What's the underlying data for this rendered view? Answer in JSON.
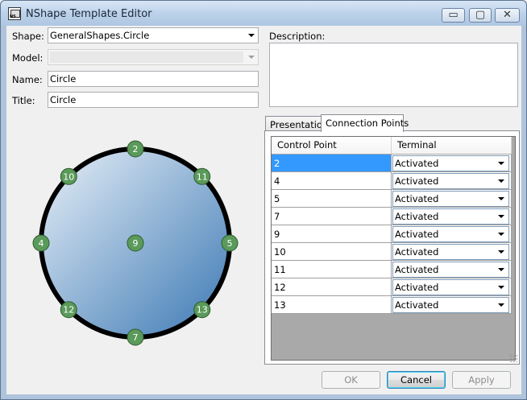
{
  "window": {
    "title": "NShape Template Editor",
    "controls": {
      "minimize": "▭",
      "maximize": "▢",
      "close": "✕"
    }
  },
  "form": {
    "shape_label": "Shape:",
    "shape_value": "GeneralShapes.Circle",
    "model_label": "Model:",
    "model_value": "",
    "name_label": "Name:",
    "name_value": "Circle",
    "title_label": "Title:",
    "title_value": "Circle",
    "description_label": "Description:",
    "description_value": ""
  },
  "preview": {
    "fill_colors": {
      "light": "#e8f0f8",
      "dark": "#3b78b3"
    },
    "outline_color": "#000000",
    "point_color": "#5a9a5a",
    "points": [
      {
        "id": "2",
        "label": "2"
      },
      {
        "id": "11",
        "label": "11"
      },
      {
        "id": "5",
        "label": "5"
      },
      {
        "id": "13",
        "label": "13"
      },
      {
        "id": "7",
        "label": "7"
      },
      {
        "id": "12",
        "label": "12"
      },
      {
        "id": "4",
        "label": "4"
      },
      {
        "id": "10",
        "label": "10"
      },
      {
        "id": "9",
        "label": "9"
      }
    ]
  },
  "tabs": {
    "presentation": "Presentation",
    "connection_points": "Connection Points"
  },
  "grid": {
    "headers": {
      "control_point": "Control Point",
      "terminal": "Terminal"
    },
    "selection_color": "#3399ff",
    "rows": [
      {
        "point": "2",
        "terminal": "Activated"
      },
      {
        "point": "4",
        "terminal": "Activated"
      },
      {
        "point": "5",
        "terminal": "Activated"
      },
      {
        "point": "7",
        "terminal": "Activated"
      },
      {
        "point": "9",
        "terminal": "Activated"
      },
      {
        "point": "10",
        "terminal": "Activated"
      },
      {
        "point": "11",
        "terminal": "Activated"
      },
      {
        "point": "12",
        "terminal": "Activated"
      },
      {
        "point": "13",
        "terminal": "Activated"
      }
    ]
  },
  "buttons": {
    "ok": "OK",
    "cancel": "Cancel",
    "apply": "Apply"
  }
}
